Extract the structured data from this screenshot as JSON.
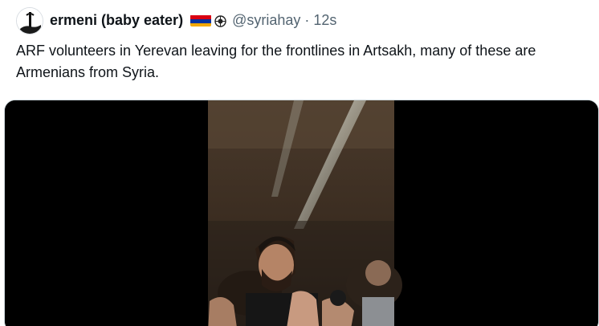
{
  "tweet": {
    "display_name": "ermeni (baby eater)",
    "handle": "@syriahay",
    "separator": "·",
    "time": "12s",
    "text": "ARF volunteers in Yerevan leaving for the frontlines in Artsakh, many of these are Armenians from Syria.",
    "flag_colors": [
      "#d90012",
      "#0033a0",
      "#f2a800"
    ],
    "icons": [
      "avatar-image",
      "armenia-flag-icon",
      "arf-emblem-icon"
    ]
  },
  "media": {
    "type": "video-frame"
  }
}
